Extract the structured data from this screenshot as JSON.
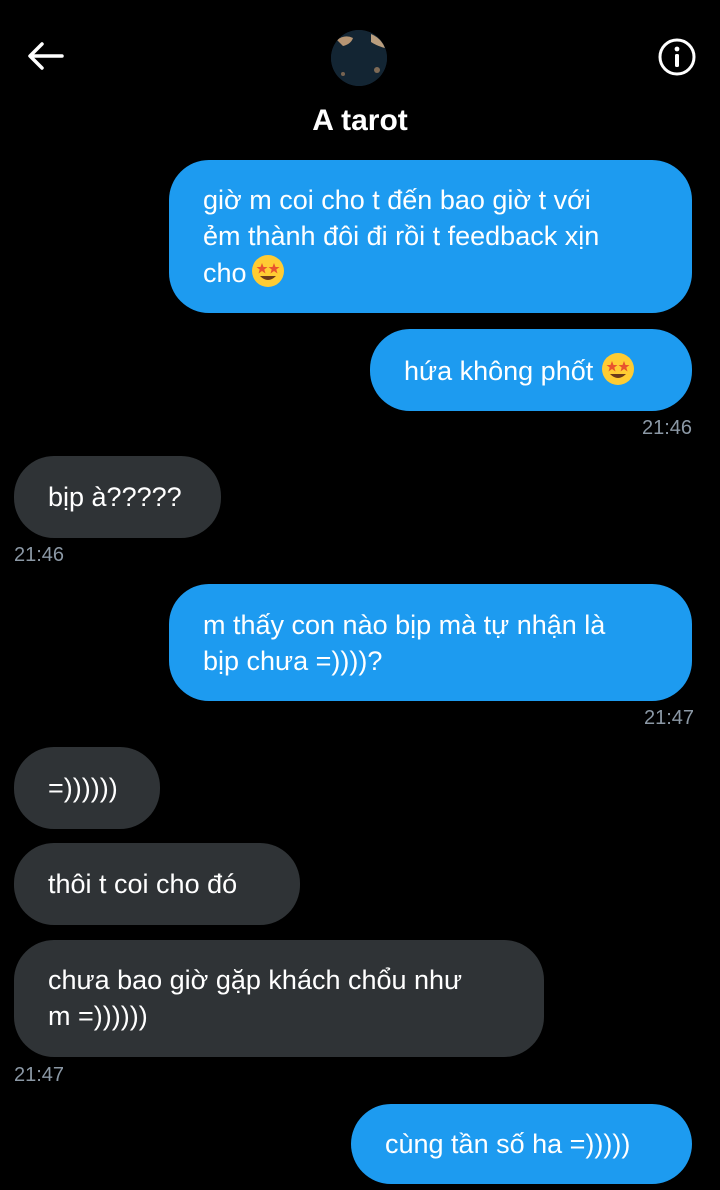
{
  "header": {
    "title": "A tarot",
    "back_icon": "arrow-left-icon",
    "info_icon": "info-icon",
    "avatar_icon": "avatar-image"
  },
  "colors": {
    "outgoing": "#1d9bf0",
    "incoming": "#2f3336",
    "timestamp": "#8b98a5",
    "background": "#000000"
  },
  "messages": [
    {
      "dir": "out",
      "lines": [
        "giờ m coi cho t đến bao giờ t với",
        "ẻm thành đôi đi rồi t feedback xịn",
        "cho"
      ],
      "emoji": "star-struck-emoji"
    },
    {
      "dir": "out",
      "lines": [
        "hứa không phốt"
      ],
      "emoji": "star-struck-emoji",
      "time": "21:46"
    },
    {
      "dir": "in",
      "lines": [
        "bịp à?????"
      ],
      "time": "21:46"
    },
    {
      "dir": "out",
      "lines": [
        "m thấy con nào bịp mà tự nhận là",
        "bịp chưa =))))?"
      ],
      "time": "21:47"
    },
    {
      "dir": "in",
      "lines": [
        "=))))))"
      ]
    },
    {
      "dir": "in",
      "lines": [
        "thôi t coi cho đó"
      ]
    },
    {
      "dir": "in",
      "lines": [
        "chưa bao giờ gặp khách chổu như",
        "m =))))))"
      ],
      "time": "21:47"
    },
    {
      "dir": "out",
      "lines": [
        "cùng tần số ha =)))))"
      ]
    }
  ]
}
